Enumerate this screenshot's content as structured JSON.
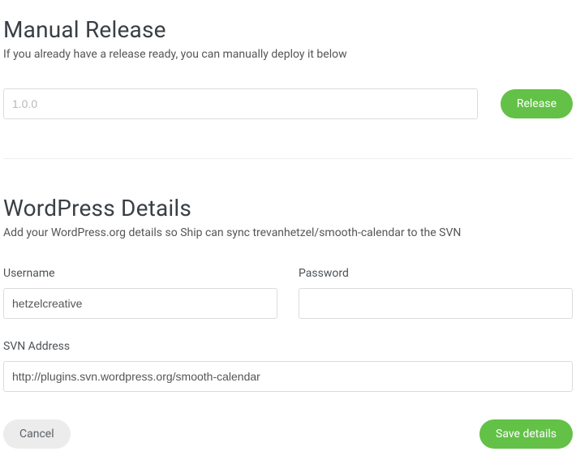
{
  "manual_release": {
    "heading": "Manual Release",
    "description": "If you already have a release ready, you can manually deploy it below",
    "version_placeholder": "1.0.0",
    "version_value": "",
    "release_button": "Release"
  },
  "wordpress_details": {
    "heading": "WordPress Details",
    "description": "Add your WordPress.org details so Ship can sync trevanhetzel/smooth-calendar to the SVN",
    "username_label": "Username",
    "username_value": "hetzelcreative",
    "password_label": "Password",
    "password_value": "",
    "svn_label": "SVN Address",
    "svn_value": "http://plugins.svn.wordpress.org/smooth-calendar",
    "cancel_button": "Cancel",
    "save_button": "Save details"
  }
}
